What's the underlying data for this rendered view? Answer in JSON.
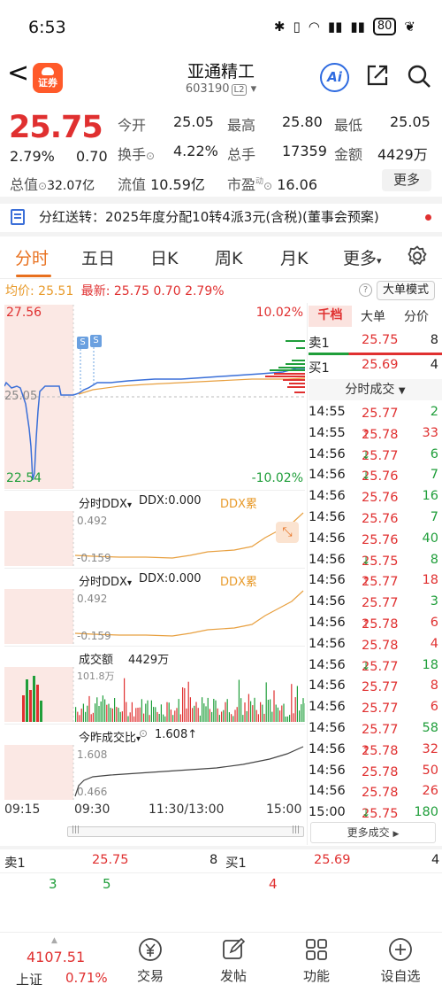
{
  "status": {
    "time": "6:53",
    "battery": "80"
  },
  "header": {
    "name": "亚通精工",
    "code": "603190",
    "level": "L2",
    "logo_text": "证券",
    "ai_label": "Ai"
  },
  "quote": {
    "price": "25.75",
    "pct": "2.79%",
    "chg": "0.70",
    "open_label": "今开",
    "open": "25.05",
    "high_label": "最高",
    "high": "25.80",
    "low_label": "最低",
    "low": "25.05",
    "turnover_label": "换手",
    "turnover": "4.22%",
    "vol_label": "总手",
    "vol": "17359",
    "amount_label": "金额",
    "amount": "4429万",
    "mcap_label": "总值",
    "mcap": "32.07亿",
    "float_label": "流值",
    "float": "10.59亿",
    "pe_label": "市盈",
    "pe_sup": "动",
    "pe": "16.06",
    "more": "更多"
  },
  "notice": "分红送转：2025年度分配10转4派3元(含税)(董事会预案)",
  "tabs": [
    "分时",
    "五日",
    "日K",
    "周K",
    "月K",
    "更多"
  ],
  "info": {
    "avg_label": "均价:",
    "avg": "25.51",
    "last_label": "最新:",
    "last": "25.75",
    "chg": "0.70",
    "pct": "2.79%",
    "big_order": "大单模式"
  },
  "price_chart": {
    "y_max": "27.56",
    "y_mid": "25.05",
    "y_min": "22.54",
    "pct_max": "10.02%",
    "pct_min": "-10.02%",
    "badge": "S"
  },
  "ddx1": {
    "name": "分时DDX",
    "ddx": "DDX:0.000",
    "cum": "DDX累计:0.492",
    "top": "0.492",
    "bot": "-0.159"
  },
  "ddx2": {
    "name": "分时DDX",
    "ddx": "DDX:0.000",
    "cum": "DDX累计:0.492",
    "top": "0.492",
    "bot": "-0.159"
  },
  "volume": {
    "name": "成交额",
    "value": "4429万",
    "max": "101.8万"
  },
  "ratio": {
    "name": "今昨成交比",
    "value": "1.608",
    "top": "1.608",
    "bot": "0.466"
  },
  "time_axis": [
    "09:15",
    "09:30",
    "11:30/13:00",
    "15:00"
  ],
  "book": {
    "tabs": [
      "千档",
      "大单",
      "分价"
    ],
    "sell1": {
      "label": "卖1",
      "price": "25.75",
      "vol": "8"
    },
    "buy1": {
      "label": "买1",
      "price": "25.69",
      "vol": "4"
    },
    "trades_title": "分时成交",
    "trades": [
      {
        "t": "14:55",
        "p": "25.77",
        "a": "",
        "v": "2",
        "vc": "green"
      },
      {
        "t": "14:55",
        "p": "25.78",
        "a": "↑",
        "v": "33",
        "vc": "red"
      },
      {
        "t": "14:56",
        "p": "25.77",
        "a": "↓",
        "v": "6",
        "vc": "green"
      },
      {
        "t": "14:56",
        "p": "25.76",
        "a": "↓",
        "v": "7",
        "vc": "green"
      },
      {
        "t": "14:56",
        "p": "25.76",
        "a": "",
        "v": "16",
        "vc": "green"
      },
      {
        "t": "14:56",
        "p": "25.76",
        "a": "",
        "v": "7",
        "vc": "green"
      },
      {
        "t": "14:56",
        "p": "25.76",
        "a": "",
        "v": "40",
        "vc": "green"
      },
      {
        "t": "14:56",
        "p": "25.75",
        "a": "↓",
        "v": "8",
        "vc": "green"
      },
      {
        "t": "14:56",
        "p": "25.77",
        "a": "↑",
        "v": "18",
        "vc": "red"
      },
      {
        "t": "14:56",
        "p": "25.77",
        "a": "",
        "v": "3",
        "vc": "green"
      },
      {
        "t": "14:56",
        "p": "25.78",
        "a": "↑",
        "v": "6",
        "vc": "red"
      },
      {
        "t": "14:56",
        "p": "25.78",
        "a": "",
        "v": "4",
        "vc": "red"
      },
      {
        "t": "14:56",
        "p": "25.77",
        "a": "↓",
        "v": "18",
        "vc": "green"
      },
      {
        "t": "14:56",
        "p": "25.77",
        "a": "",
        "v": "8",
        "vc": "red"
      },
      {
        "t": "14:56",
        "p": "25.77",
        "a": "",
        "v": "6",
        "vc": "red"
      },
      {
        "t": "14:56",
        "p": "25.77",
        "a": "",
        "v": "58",
        "vc": "green"
      },
      {
        "t": "14:56",
        "p": "25.78",
        "a": "↑",
        "v": "32",
        "vc": "red"
      },
      {
        "t": "14:56",
        "p": "25.78",
        "a": "",
        "v": "50",
        "vc": "red"
      },
      {
        "t": "14:56",
        "p": "25.78",
        "a": "",
        "v": "26",
        "vc": "red"
      },
      {
        "t": "15:00",
        "p": "25.75",
        "a": "↓",
        "v": "180",
        "vc": "green"
      }
    ],
    "more_trades": "更多成交"
  },
  "bottom_quote": {
    "sell_label": "卖1",
    "sell_price": "25.75",
    "sell_vol": "8",
    "buy_label": "买1",
    "buy_price": "25.69",
    "buy_vol": "4",
    "n1": "3",
    "n2": "5",
    "n3": "4"
  },
  "footer": {
    "index_value": "4107.51",
    "index_name": "上证",
    "index_pct": "0.71%",
    "items": [
      "交易",
      "发帖",
      "功能",
      "设自选"
    ]
  },
  "colors": {
    "up": "#e03030",
    "down": "#1f9e3a",
    "accent": "#e8701e",
    "avg_line": "#e8a040",
    "price_line": "#3a6fd8"
  }
}
